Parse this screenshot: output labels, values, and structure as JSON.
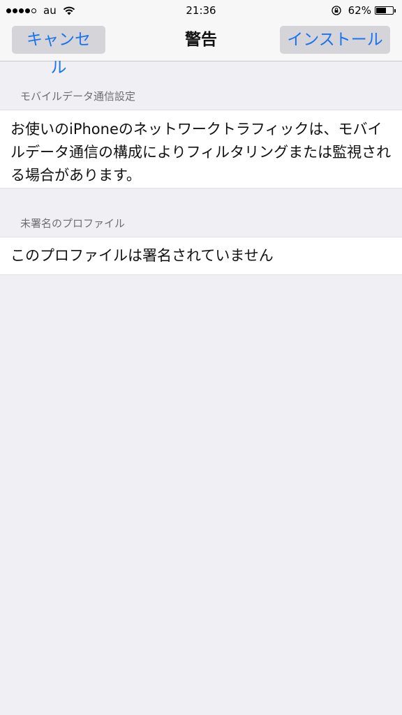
{
  "status_bar": {
    "carrier": "au",
    "time": "21:36",
    "battery_percent": "62%",
    "battery_level": 0.62,
    "signal_bars_filled": 4,
    "signal_bars_total": 5,
    "icons": [
      "signal-dots-icon",
      "wifi-icon",
      "rotation-lock-icon",
      "battery-icon"
    ]
  },
  "nav": {
    "cancel_label": "キャンセル",
    "title": "警告",
    "install_label": "インストール"
  },
  "sections": [
    {
      "header": "モバイルデータ通信設定",
      "body": "お使いのiPhoneのネットワークトラフィックは、モバイルデータ通信の構成によりフィルタリングまたは監視される場合があります。"
    },
    {
      "header": "未署名のプロファイル",
      "body": "このプロファイルは署名されていません"
    }
  ],
  "colors": {
    "accent": "#1a74f2",
    "background": "#efeff4",
    "button_bg": "#d4d4d9",
    "section_header": "#6d6d72"
  }
}
